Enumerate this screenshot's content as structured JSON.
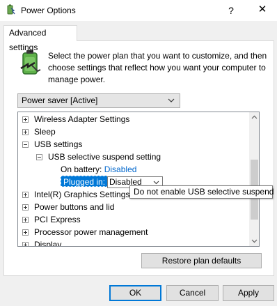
{
  "window": {
    "title": "Power Options",
    "help_label": "?",
    "close_label": "✕"
  },
  "tab": {
    "label": "Advanced settings"
  },
  "intro_text": "Select the power plan that you want to customize, and then choose settings that reflect how you want your computer to manage power.",
  "plan_select": {
    "value": "Power saver [Active]"
  },
  "tree": {
    "items": [
      {
        "label": "Wireless Adapter Settings",
        "expander": "plus"
      },
      {
        "label": "Sleep",
        "expander": "plus"
      },
      {
        "label": "USB settings",
        "expander": "minus"
      },
      {
        "label": "USB selective suspend setting",
        "expander": "minus"
      },
      {
        "label": "On battery:",
        "value": "Disabled"
      },
      {
        "label": "Plugged in:",
        "value": "Disabled"
      },
      {
        "label": "Intel(R) Graphics Settings",
        "expander": "plus"
      },
      {
        "label": "Power buttons and lid",
        "expander": "plus"
      },
      {
        "label": "PCI Express",
        "expander": "plus"
      },
      {
        "label": "Processor power management",
        "expander": "plus"
      },
      {
        "label": "Display",
        "expander": "plus"
      }
    ]
  },
  "tooltip": {
    "text": "Do not enable USB selective suspend"
  },
  "buttons": {
    "restore": "Restore plan defaults",
    "ok": "OK",
    "cancel": "Cancel",
    "apply": "Apply"
  },
  "colors": {
    "accent": "#0078d7",
    "link": "#0066cc"
  },
  "icons": {
    "app": "power-options-icon",
    "battery": "battery-plug-icon"
  }
}
